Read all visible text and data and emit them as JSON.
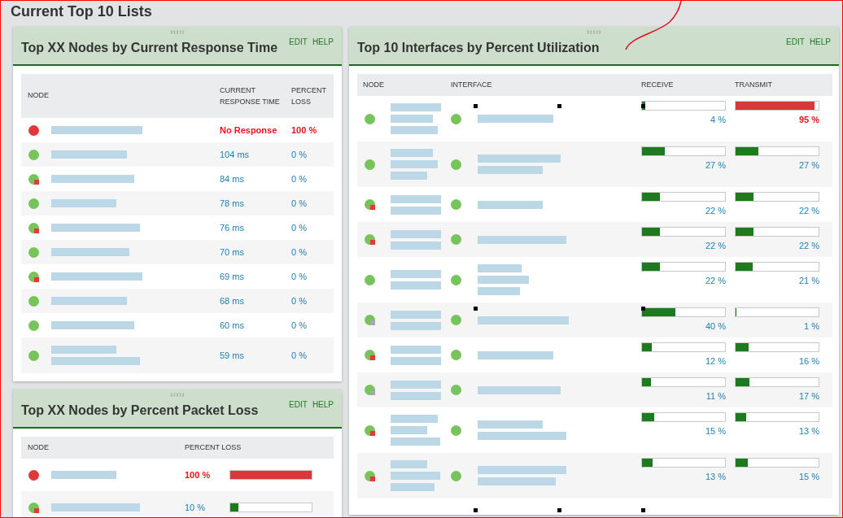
{
  "page_title": "Current Top 10 Lists",
  "response_panel": {
    "title": "Top XX Nodes by Current Response Time",
    "actions": [
      "EDIT",
      "HELP"
    ],
    "columns": [
      "NODE",
      "CURRENT RESPONSE TIME",
      "PERCENT LOSS"
    ],
    "rows": [
      {
        "status": {
          "color": "#e0383a"
        },
        "response": "No Response",
        "loss": "100 %",
        "alert": true
      },
      {
        "status": {
          "color": "#78c45c"
        },
        "response": "104 ms",
        "loss": "0 %",
        "alert": false
      },
      {
        "status": {
          "color": "#78c45c",
          "badge": {
            "color": "#e53935"
          }
        },
        "response": "84 ms",
        "loss": "0 %",
        "alert": false
      },
      {
        "status": {
          "color": "#78c45c"
        },
        "response": "78 ms",
        "loss": "0 %",
        "alert": false
      },
      {
        "status": {
          "color": "#78c45c",
          "badge": {
            "color": "#e53935"
          }
        },
        "response": "76 ms",
        "loss": "0 %",
        "alert": false
      },
      {
        "status": {
          "color": "#78c45c"
        },
        "response": "70 ms",
        "loss": "0 %",
        "alert": false
      },
      {
        "status": {
          "color": "#78c45c",
          "badge": {
            "color": "#e53935"
          }
        },
        "response": "69 ms",
        "loss": "0 %",
        "alert": false
      },
      {
        "status": {
          "color": "#78c45c"
        },
        "response": "68 ms",
        "loss": "0 %",
        "alert": false
      },
      {
        "status": {
          "color": "#78c45c"
        },
        "response": "60 ms",
        "loss": "0 %",
        "alert": false
      },
      {
        "status": {
          "color": "#78c45c"
        },
        "response": "59 ms",
        "loss": "0 %",
        "alert": false
      }
    ]
  },
  "loss_panel": {
    "title": "Top XX Nodes by Percent Packet Loss",
    "actions": [
      "EDIT",
      "HELP"
    ],
    "columns": [
      "NODE",
      "PERCENT LOSS"
    ],
    "rows": [
      {
        "status": {
          "color": "#e0383a"
        },
        "loss": "100 %",
        "level": 1.0,
        "alert": true
      },
      {
        "status": {
          "color": "#78c45c",
          "badge": {
            "color": "#e53935"
          }
        },
        "loss": "10 %",
        "level": 0.1,
        "alert": false
      }
    ]
  },
  "interfaces_panel": {
    "title": "Top 10 Interfaces by Percent Utilization",
    "actions": [
      "EDIT",
      "HELP"
    ],
    "columns": [
      "NODE",
      "INTERFACE",
      "RECEIVE",
      "TRANSMIT"
    ],
    "rows": [
      {
        "node_status": {
          "color": "#78c45c"
        },
        "interface_status": {
          "color": "#78c45c"
        },
        "receive": {
          "text": "4 %",
          "level": 0.04,
          "alert": false
        },
        "transmit": {
          "text": "95 %",
          "level": 0.95,
          "alert": true
        }
      },
      {
        "node_status": {
          "color": "#78c45c"
        },
        "interface_status": {
          "color": "#78c45c"
        },
        "receive": {
          "text": "27 %",
          "level": 0.27,
          "alert": false
        },
        "transmit": {
          "text": "27 %",
          "level": 0.27,
          "alert": false
        }
      },
      {
        "node_status": {
          "color": "#78c45c",
          "badge": {
            "color": "#e53935"
          }
        },
        "interface_status": {
          "color": "#78c45c"
        },
        "receive": {
          "text": "22 %",
          "level": 0.22,
          "alert": false
        },
        "transmit": {
          "text": "22 %",
          "level": 0.22,
          "alert": false
        }
      },
      {
        "node_status": {
          "color": "#78c45c",
          "badge": {
            "color": "#e53935"
          }
        },
        "interface_status": {
          "color": "#78c45c"
        },
        "receive": {
          "text": "22 %",
          "level": 0.22,
          "alert": false
        },
        "transmit": {
          "text": "22 %",
          "level": 0.22,
          "alert": false
        }
      },
      {
        "node_status": {
          "color": "#78c45c"
        },
        "interface_status": {
          "color": "#78c45c"
        },
        "receive": {
          "text": "22 %",
          "level": 0.22,
          "alert": false
        },
        "transmit": {
          "text": "21 %",
          "level": 0.21,
          "alert": false
        }
      },
      {
        "node_status": {
          "color": "#78c45c",
          "badge": {
            "color": "#a8a8a8"
          }
        },
        "interface_status": {
          "color": "#78c45c"
        },
        "receive": {
          "text": "40 %",
          "level": 0.4,
          "alert": false
        },
        "transmit": {
          "text": "1 %",
          "level": 0.01,
          "alert": false
        }
      },
      {
        "node_status": {
          "color": "#78c45c",
          "badge": {
            "color": "#e53935"
          }
        },
        "interface_status": {
          "color": "#78c45c"
        },
        "receive": {
          "text": "12 %",
          "level": 0.12,
          "alert": false
        },
        "transmit": {
          "text": "16 %",
          "level": 0.16,
          "alert": false
        }
      },
      {
        "node_status": {
          "color": "#78c45c",
          "badge": {
            "color": "#a8a8a8"
          }
        },
        "interface_status": {
          "color": "#78c45c"
        },
        "receive": {
          "text": "11 %",
          "level": 0.11,
          "alert": false
        },
        "transmit": {
          "text": "17 %",
          "level": 0.17,
          "alert": false
        }
      },
      {
        "node_status": {
          "color": "#78c45c",
          "badge": {
            "color": "#e53935"
          }
        },
        "interface_status": {
          "color": "#78c45c"
        },
        "receive": {
          "text": "15 %",
          "level": 0.15,
          "alert": false
        },
        "transmit": {
          "text": "13 %",
          "level": 0.13,
          "alert": false
        }
      },
      {
        "node_status": {
          "color": "#78c45c",
          "badge": {
            "color": "#e53935"
          }
        },
        "interface_status": {
          "color": "#78c45c"
        },
        "receive": {
          "text": "13 %",
          "level": 0.13,
          "alert": false
        },
        "transmit": {
          "text": "15 %",
          "level": 0.15,
          "alert": false
        }
      }
    ]
  }
}
